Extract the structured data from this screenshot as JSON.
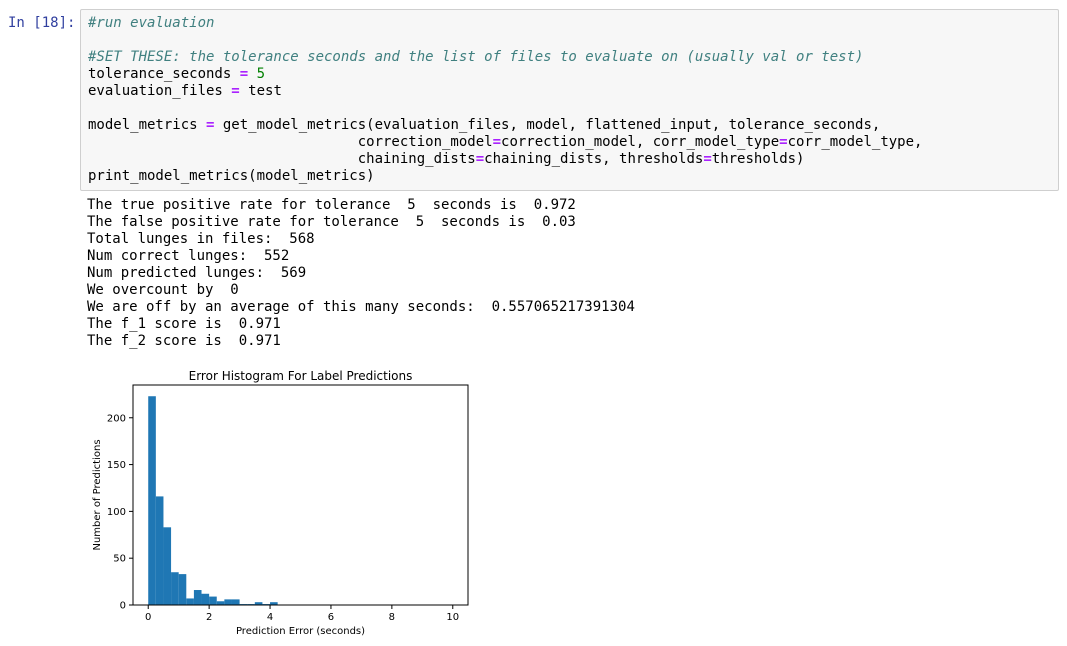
{
  "cell": {
    "prompt": "In [18]:",
    "code": [
      [
        {
          "t": "#run evaluation",
          "c": "cm"
        }
      ],
      [],
      [
        {
          "t": "#SET THESE: the tolerance seconds and the list of files to evaluate on (usually val or test)",
          "c": "cm"
        }
      ],
      [
        {
          "t": "tolerance_seconds ",
          "c": ""
        },
        {
          "t": "=",
          "c": "op"
        },
        {
          "t": " ",
          "c": ""
        },
        {
          "t": "5",
          "c": "num"
        }
      ],
      [
        {
          "t": "evaluation_files ",
          "c": ""
        },
        {
          "t": "=",
          "c": "op"
        },
        {
          "t": " test",
          "c": ""
        }
      ],
      [],
      [
        {
          "t": "model_metrics ",
          "c": ""
        },
        {
          "t": "=",
          "c": "op"
        },
        {
          "t": " get_model_metrics(evaluation_files, model, flattened_input, tolerance_seconds,",
          "c": ""
        }
      ],
      [
        {
          "t": "                                correction_model",
          "c": ""
        },
        {
          "t": "=",
          "c": "op"
        },
        {
          "t": "correction_model, corr_model_type",
          "c": ""
        },
        {
          "t": "=",
          "c": "op"
        },
        {
          "t": "corr_model_type,",
          "c": ""
        }
      ],
      [
        {
          "t": "                                chaining_dists",
          "c": ""
        },
        {
          "t": "=",
          "c": "op"
        },
        {
          "t": "chaining_dists, thresholds",
          "c": ""
        },
        {
          "t": "=",
          "c": "op"
        },
        {
          "t": "thresholds)",
          "c": ""
        }
      ],
      [
        {
          "t": "print_model_metrics(model_metrics)",
          "c": ""
        }
      ]
    ]
  },
  "output": {
    "lines": [
      "The true positive rate for tolerance  5  seconds is  0.972",
      "The false positive rate for tolerance  5  seconds is  0.03",
      "Total lunges in files:  568",
      "Num correct lunges:  552",
      "Num predicted lunges:  569",
      "We overcount by  0",
      "We are off by an average of this many seconds:  0.557065217391304",
      "The f_1 score is  0.971",
      "The f_2 score is  0.971"
    ]
  },
  "chart_data": {
    "type": "bar",
    "title": "Error Histogram For Label Predictions",
    "xlabel": "Prediction Error (seconds)",
    "ylabel": "Number of Predictions",
    "xlim": [
      -0.5,
      10.5
    ],
    "ylim": [
      0,
      235
    ],
    "xticks": [
      0,
      2,
      4,
      6,
      8,
      10
    ],
    "yticks": [
      0,
      50,
      100,
      150,
      200
    ],
    "bin_width": 0.25,
    "bin_edges_start": 0,
    "values": [
      223,
      116,
      83,
      35,
      33,
      7,
      16,
      12,
      9,
      4,
      6,
      6,
      1,
      1,
      3,
      1,
      3
    ],
    "color": "#1f77b4",
    "grid": false
  }
}
